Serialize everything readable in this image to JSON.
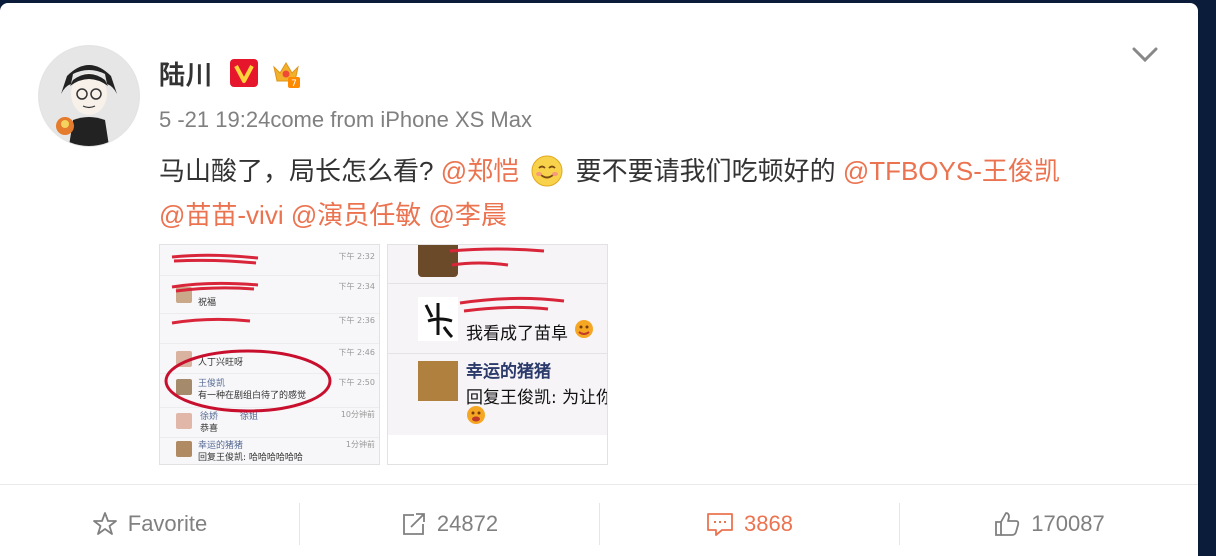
{
  "post": {
    "author": "陆川",
    "time": "5 -21 19:24",
    "source": "come from iPhone XS Max",
    "text_part1": "马山酸了，局长怎么看?",
    "mention1": "@郑恺",
    "text_part2": " 要不要请我们吃顿好的 ",
    "mention2": "@TFBOYS-王俊凯",
    "mention3": "@苗苗-vivi",
    "mention4": "@演员任敏",
    "mention5": "@李晨",
    "icons": [
      "chevron-down-icon",
      "verified-v-icon",
      "crown-icon",
      "smile-emoji-icon"
    ]
  },
  "image1": {
    "times": [
      "下午 2:32",
      "下午 2:34",
      "下午 2:36",
      "下午 2:46",
      "下午 2:50",
      "10分钟前",
      "1分钟前"
    ],
    "line1": "祝福",
    "line2": "人丁兴旺呀",
    "name5": "王俊凯",
    "line5": "有一种在剧组白待了的感觉",
    "name6a": "徐娇",
    "name6b": "徐姐",
    "line6": "恭喜",
    "name7": "幸运的猪猪",
    "line7": "回复王俊凯: 哈哈哈哈哈哈"
  },
  "image2": {
    "line1": "我看成了苗阜",
    "name2": "幸运的猪猪",
    "line2": "回复王俊凯: 为让你"
  },
  "actions": {
    "favorite": "Favorite",
    "repost": "24872",
    "comment": "3868",
    "like": "170087"
  },
  "colors": {
    "accent": "#eb7350",
    "meta": "#808080",
    "text": "#333333"
  }
}
